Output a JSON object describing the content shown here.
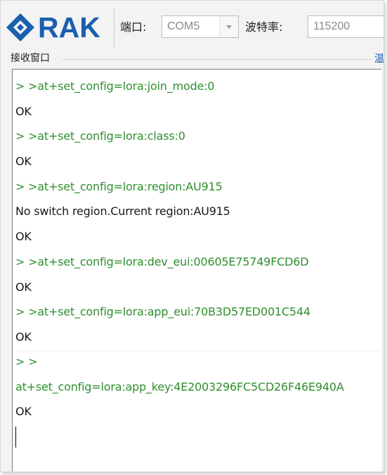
{
  "toolbar": {
    "logo_text": "RAK",
    "port_label": "端口:",
    "port_value": "COM5",
    "baud_label": "波特率:",
    "baud_value": "115200"
  },
  "receive_window": {
    "title": "接收窗口",
    "right_glyph": "温",
    "lines": [
      {
        "text": "> >at+set_config=lora:join_mode:0",
        "kind": "command"
      },
      {
        "text": "OK",
        "kind": "response"
      },
      {
        "text": "> >at+set_config=lora:class:0",
        "kind": "command"
      },
      {
        "text": "OK",
        "kind": "response"
      },
      {
        "text": "> >at+set_config=lora:region:AU915",
        "kind": "command"
      },
      {
        "text": "No switch region.Current region:AU915",
        "kind": "response"
      },
      {
        "text": "OK",
        "kind": "response"
      },
      {
        "text": "> >at+set_config=lora:dev_eui:00605E75749FCD6D",
        "kind": "command"
      },
      {
        "text": "OK",
        "kind": "response"
      },
      {
        "text": "> >at+set_config=lora:app_eui:70B3D57ED001C544",
        "kind": "command"
      },
      {
        "text": "OK",
        "kind": "response"
      },
      {
        "text": "> >",
        "kind": "command"
      },
      {
        "text": "at+set_config=lora:app_key:4E2003296FC5CD26F46E940A",
        "kind": "command"
      },
      {
        "text": "OK",
        "kind": "response"
      }
    ]
  },
  "colors": {
    "brand": "#1b5fae",
    "command_text": "#2f8f2f",
    "response_text": "#1a1a1a"
  }
}
